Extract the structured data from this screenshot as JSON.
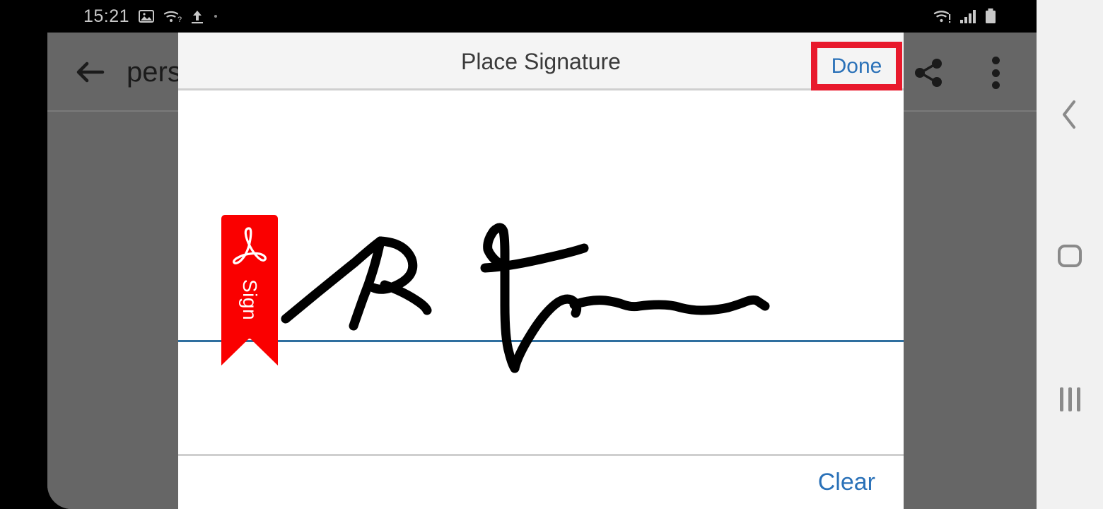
{
  "status_bar": {
    "clock": "15:21",
    "left_icons": [
      "image-icon",
      "wifi-question-icon",
      "upload-icon",
      "dot-icon"
    ],
    "right_icons": [
      "wifi-alert-icon",
      "signal-bars-icon",
      "battery-icon"
    ]
  },
  "app": {
    "back_icon": "back-arrow-icon",
    "title": "pers",
    "share_icon": "share-icon",
    "overflow_icon": "overflow-menu-icon"
  },
  "dialog": {
    "title": "Place Signature",
    "done_label": "Done",
    "clear_label": "Clear",
    "highlight_color": "#e8192c",
    "accent_color": "#2a71b8",
    "baseline_color": "#2f6f9f",
    "sign_tag": {
      "label": "Sign",
      "color": "#fa0000",
      "logo_icon": "adobe-acrobat-icon"
    },
    "signature": {
      "ink_color": "#000000",
      "description": "handwritten-signature"
    }
  },
  "nav_bar": {
    "back_label": "back-icon",
    "home_label": "home-icon",
    "recents_label": "recents-icon"
  }
}
